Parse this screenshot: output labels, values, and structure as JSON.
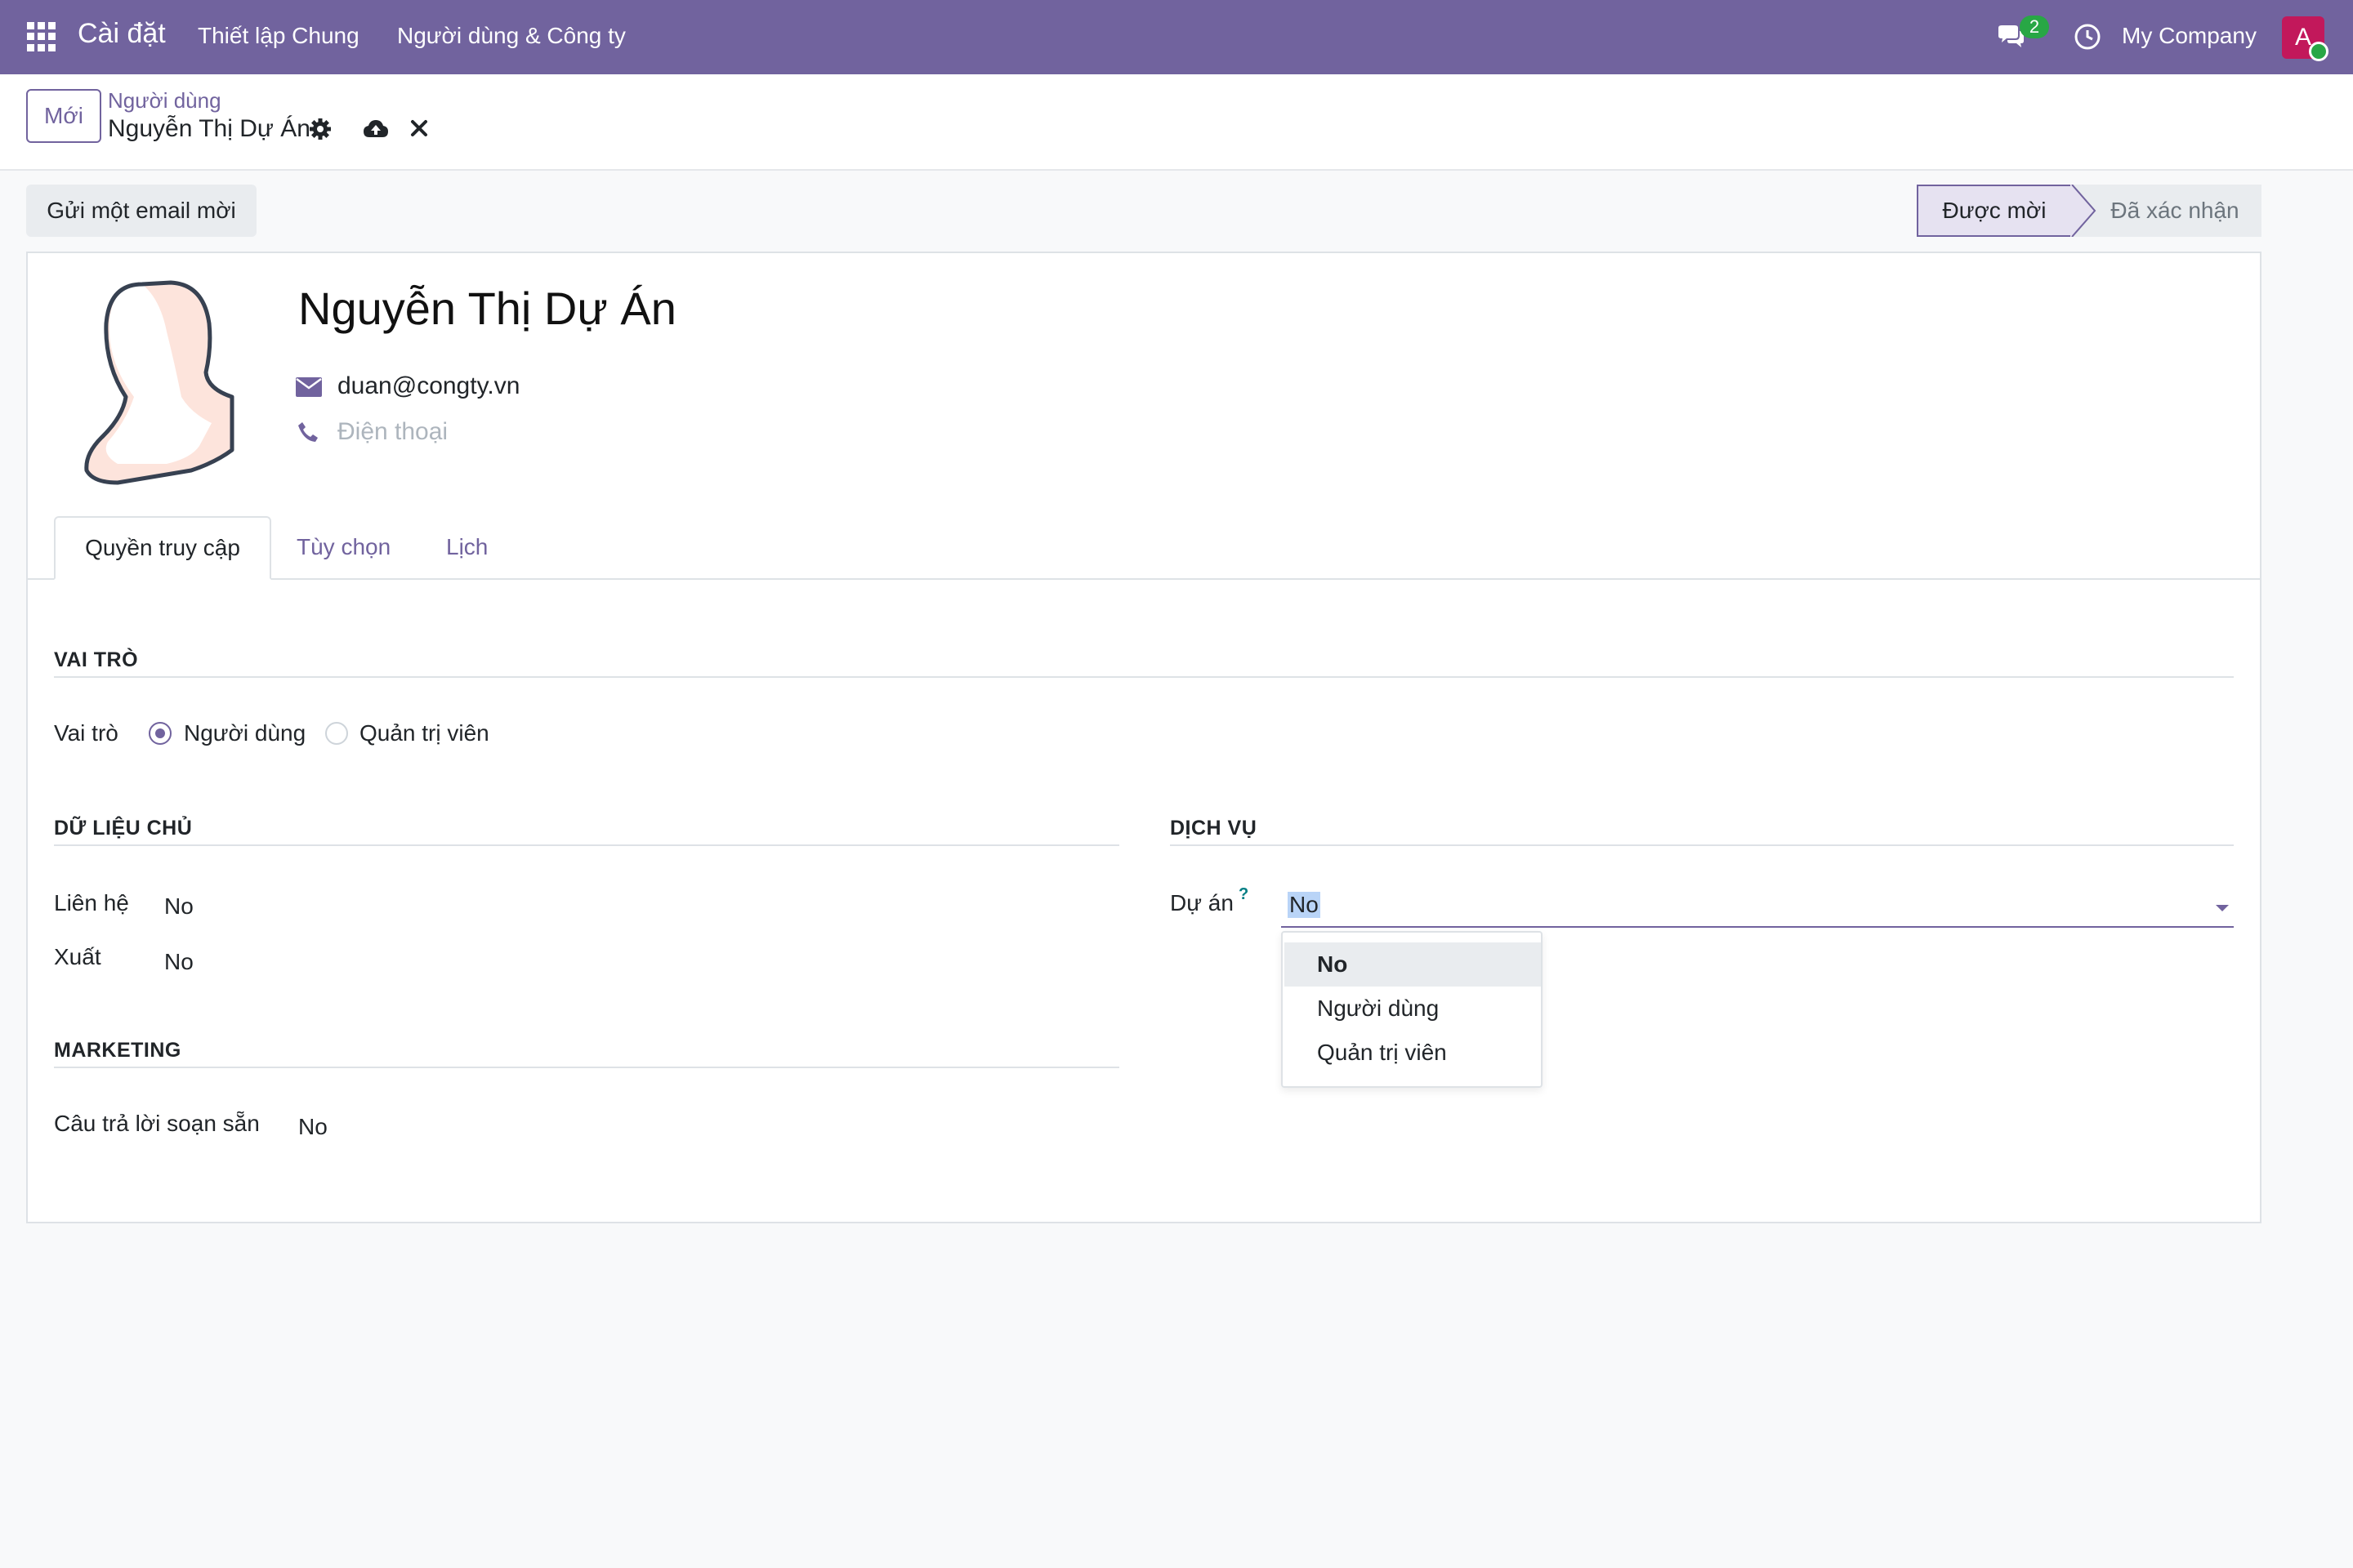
{
  "navbar": {
    "app_name": "Cài đặt",
    "menu": [
      "Thiết lập Chung",
      "Người dùng & Công ty"
    ],
    "chat_count": "2",
    "company": "My Company",
    "avatar_letter": "A",
    "bg_color": "#71639e"
  },
  "control_panel": {
    "new_button": "Mới",
    "breadcrumb_parent": "Người dùng",
    "breadcrumb_current": "Nguyễn Thị Dự Án"
  },
  "actions": {
    "invite_button": "Gửi một email mời"
  },
  "status": {
    "stages": [
      "Được mời",
      "Đã xác nhận"
    ],
    "active": "Được mời"
  },
  "user": {
    "name": "Nguyễn Thị Dự Án",
    "email": "duan@congty.vn",
    "phone_placeholder": "Điện thoại"
  },
  "tabs": [
    "Quyền truy cập",
    "Tùy chọn",
    "Lịch"
  ],
  "role_section": {
    "title": "VAI TRÒ",
    "label": "Vai trò",
    "options": [
      "Người dùng",
      "Quản trị viên"
    ],
    "selected": "Người dùng"
  },
  "master_data": {
    "title": "DỮ LIỆU CHỦ",
    "fields": [
      {
        "label": "Liên hệ",
        "value": "No"
      },
      {
        "label": "Xuất",
        "value": "No"
      }
    ]
  },
  "services": {
    "title": "DỊCH VỤ",
    "project_label": "Dự án",
    "help": "?",
    "project_value": "No",
    "dropdown_options": [
      "No",
      "Người dùng",
      "Quản trị viên"
    ]
  },
  "marketing": {
    "title": "MARKETING",
    "fields": [
      {
        "label": "Câu trả lời soạn sẵn",
        "value": "No"
      }
    ]
  }
}
